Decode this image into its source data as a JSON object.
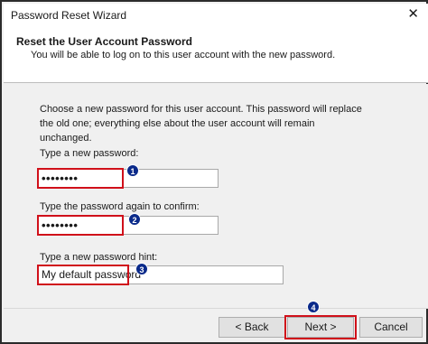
{
  "window": {
    "title": "Password Reset Wizard",
    "close_glyph": "✕"
  },
  "header": {
    "title": "Reset the User Account Password",
    "subtitle": "You will be able to log on to this user account with the new password."
  },
  "main": {
    "description": "Choose a new password for this user account. This password will replace the old one; everything else about the user account will remain unchanged.",
    "new_password_label": "Type a new password:",
    "new_password_value": "••••••••",
    "confirm_password_label": "Type the password again to confirm:",
    "confirm_password_value": "••••••••",
    "hint_label": "Type a new password hint:",
    "hint_value": "My default password"
  },
  "markers": [
    "1",
    "2",
    "3",
    "4"
  ],
  "buttons": {
    "back": "< Back",
    "next": "Next >",
    "cancel": "Cancel"
  },
  "colors": {
    "highlight": "#d0101a",
    "marker": "#0a2a8a"
  }
}
